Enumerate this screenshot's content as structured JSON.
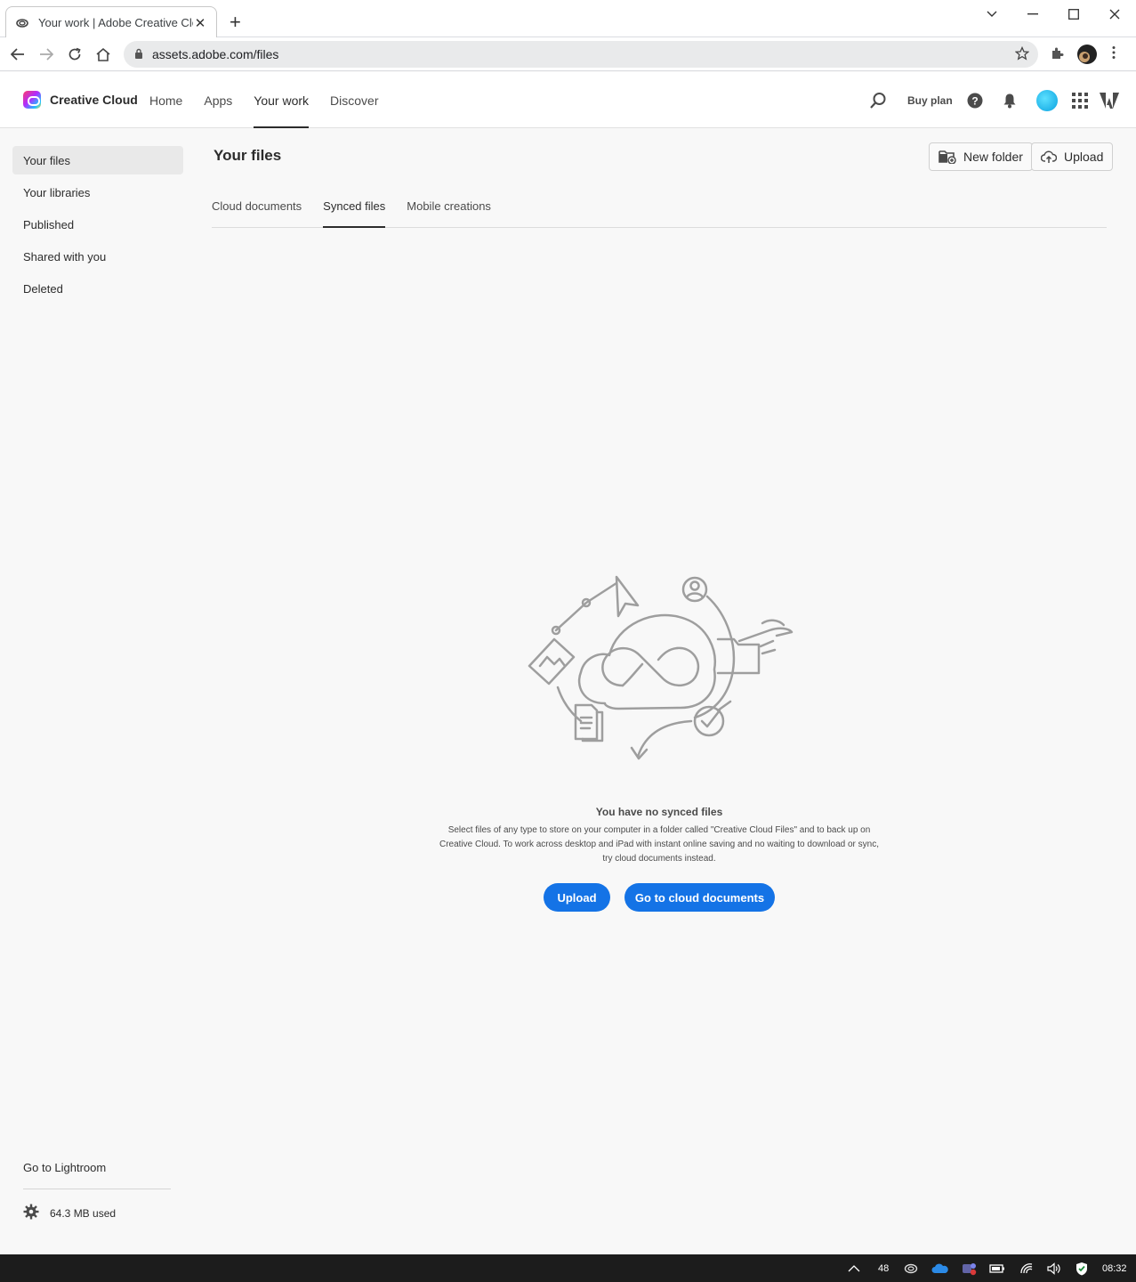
{
  "browser": {
    "tab_title": "Your work | Adobe Creative Clouc",
    "url": "assets.adobe.com/files"
  },
  "app": {
    "brand": "Creative Cloud",
    "nav": [
      "Home",
      "Apps",
      "Your work",
      "Discover"
    ],
    "active_nav": "Your work",
    "buy_plan": "Buy plan",
    "accent": "#1473e6"
  },
  "sidebar": {
    "items": [
      {
        "label": "Your files",
        "active": true
      },
      {
        "label": "Your libraries",
        "active": false
      },
      {
        "label": "Published",
        "active": false
      },
      {
        "label": "Shared with you",
        "active": false
      },
      {
        "label": "Deleted",
        "active": false
      }
    ],
    "lightroom_link": "Go to Lightroom",
    "storage_used": "64.3 MB used"
  },
  "main": {
    "title": "Your files",
    "new_folder": "New folder",
    "upload": "Upload",
    "tabs": [
      "Cloud documents",
      "Synced files",
      "Mobile creations"
    ],
    "active_tab": "Synced files"
  },
  "empty_state": {
    "title": "You have no synced files",
    "desc_line1": "Select files of any type to store on your computer in a folder called \"Creative Cloud Files\" and to back up on",
    "desc_line2": "Creative Cloud. To work across desktop and iPad with instant online saving and no waiting to download or sync,",
    "desc_line3": "try cloud documents instead.",
    "upload_button": "Upload",
    "cloud_docs_button": "Go to cloud documents"
  },
  "taskbar": {
    "temp": "48",
    "time": "08:32"
  }
}
